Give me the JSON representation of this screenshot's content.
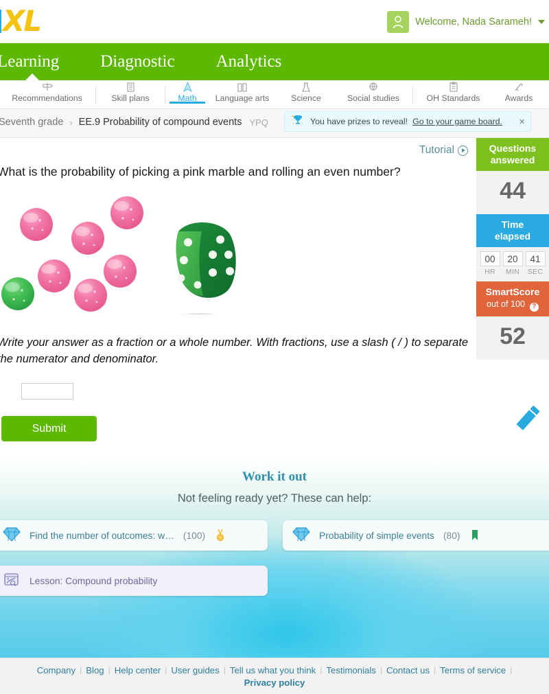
{
  "header": {
    "logo_i": "I",
    "logo_xl": "XL",
    "welcome": "Welcome, Nada Sarameh!",
    "avatar_icon": "user-avatar-icon",
    "caret_icon": "chevron-down-icon"
  },
  "mainnav": {
    "items": [
      {
        "label": "Learning",
        "active": true
      },
      {
        "label": "Diagnostic",
        "active": false
      },
      {
        "label": "Analytics",
        "active": false
      }
    ]
  },
  "subjectnav": {
    "items": [
      {
        "label": "Recommendations",
        "icon": "signpost-icon",
        "active": false
      },
      {
        "label": "Skill plans",
        "icon": "checklist-icon",
        "active": false
      },
      {
        "label": "Math",
        "icon": "compass-icon",
        "active": true
      },
      {
        "label": "Language arts",
        "icon": "open-book-icon",
        "active": false
      },
      {
        "label": "Science",
        "icon": "flask-icon",
        "active": false
      },
      {
        "label": "Social studies",
        "icon": "globe-icon",
        "active": false
      },
      {
        "label": "OH Standards",
        "icon": "clipboard-icon",
        "active": false
      },
      {
        "label": "Awards",
        "icon": "ribbon-icon",
        "active": false
      }
    ]
  },
  "breadcrumb": {
    "grade": "Seventh grade",
    "chevron": "›",
    "skill": "EE.9 Probability of compound events",
    "code": "YPQ"
  },
  "prize_banner": {
    "icon": "trophy-icon",
    "text": "You have prizes to reveal!",
    "link": "Go to your game board.",
    "close": "×"
  },
  "question": {
    "tutorial_label": "Tutorial",
    "tutorial_icon": "play-circle-icon",
    "prompt": "What is the probability of picking a pink marble and rolling an even number?",
    "instruction": "Write your answer as a fraction or a whole number. With fractions, use a slash ( / ) to separate the numerator and denominator.",
    "answer_value": "",
    "answer_placeholder": "",
    "submit_label": "Submit",
    "pencil_icon": "pencil-scratchpad-icon",
    "figure": {
      "name": "marbles-and-die-figure",
      "pink_marble_count": 6,
      "green_marble_count": 1,
      "die_color": "#1f8a3c",
      "pink_color": "#ef6ea0",
      "green_color": "#3cb44a"
    }
  },
  "rail": {
    "questions": {
      "title_line1": "Questions",
      "title_line2": "answered",
      "value": "44",
      "color": "#7ec11e"
    },
    "time": {
      "title_line1": "Time",
      "title_line2": "elapsed",
      "color": "#29abe2",
      "hr": "00",
      "min": "20",
      "sec": "41",
      "hr_label": "HR",
      "min_label": "MIN",
      "sec_label": "SEC"
    },
    "smartscore": {
      "title": "SmartScore",
      "subtitle": "out of 100",
      "help": "?",
      "value": "52",
      "color": "#e0643c"
    }
  },
  "workitout": {
    "title": "Work it out",
    "subtitle": "Not feeling ready yet? These can help:",
    "cards": [
      {
        "icon": "diamond-icon",
        "label": "Find the number of outcomes: w…",
        "count": "(100)",
        "badge": "gold-medal-icon"
      },
      {
        "icon": "diamond-icon",
        "label": "Probability of simple events",
        "count": "(80)",
        "badge": "green-ribbon-icon"
      },
      {
        "icon": "lesson-icon",
        "label": "Lesson: Compound probability",
        "count": "",
        "badge": ""
      }
    ]
  },
  "footer": {
    "links": [
      "Company",
      "Blog",
      "Help center",
      "User guides",
      "Tell us what you think",
      "Testimonials",
      "Contact us",
      "Terms of service"
    ],
    "separator": "|",
    "privacy": "Privacy policy"
  }
}
